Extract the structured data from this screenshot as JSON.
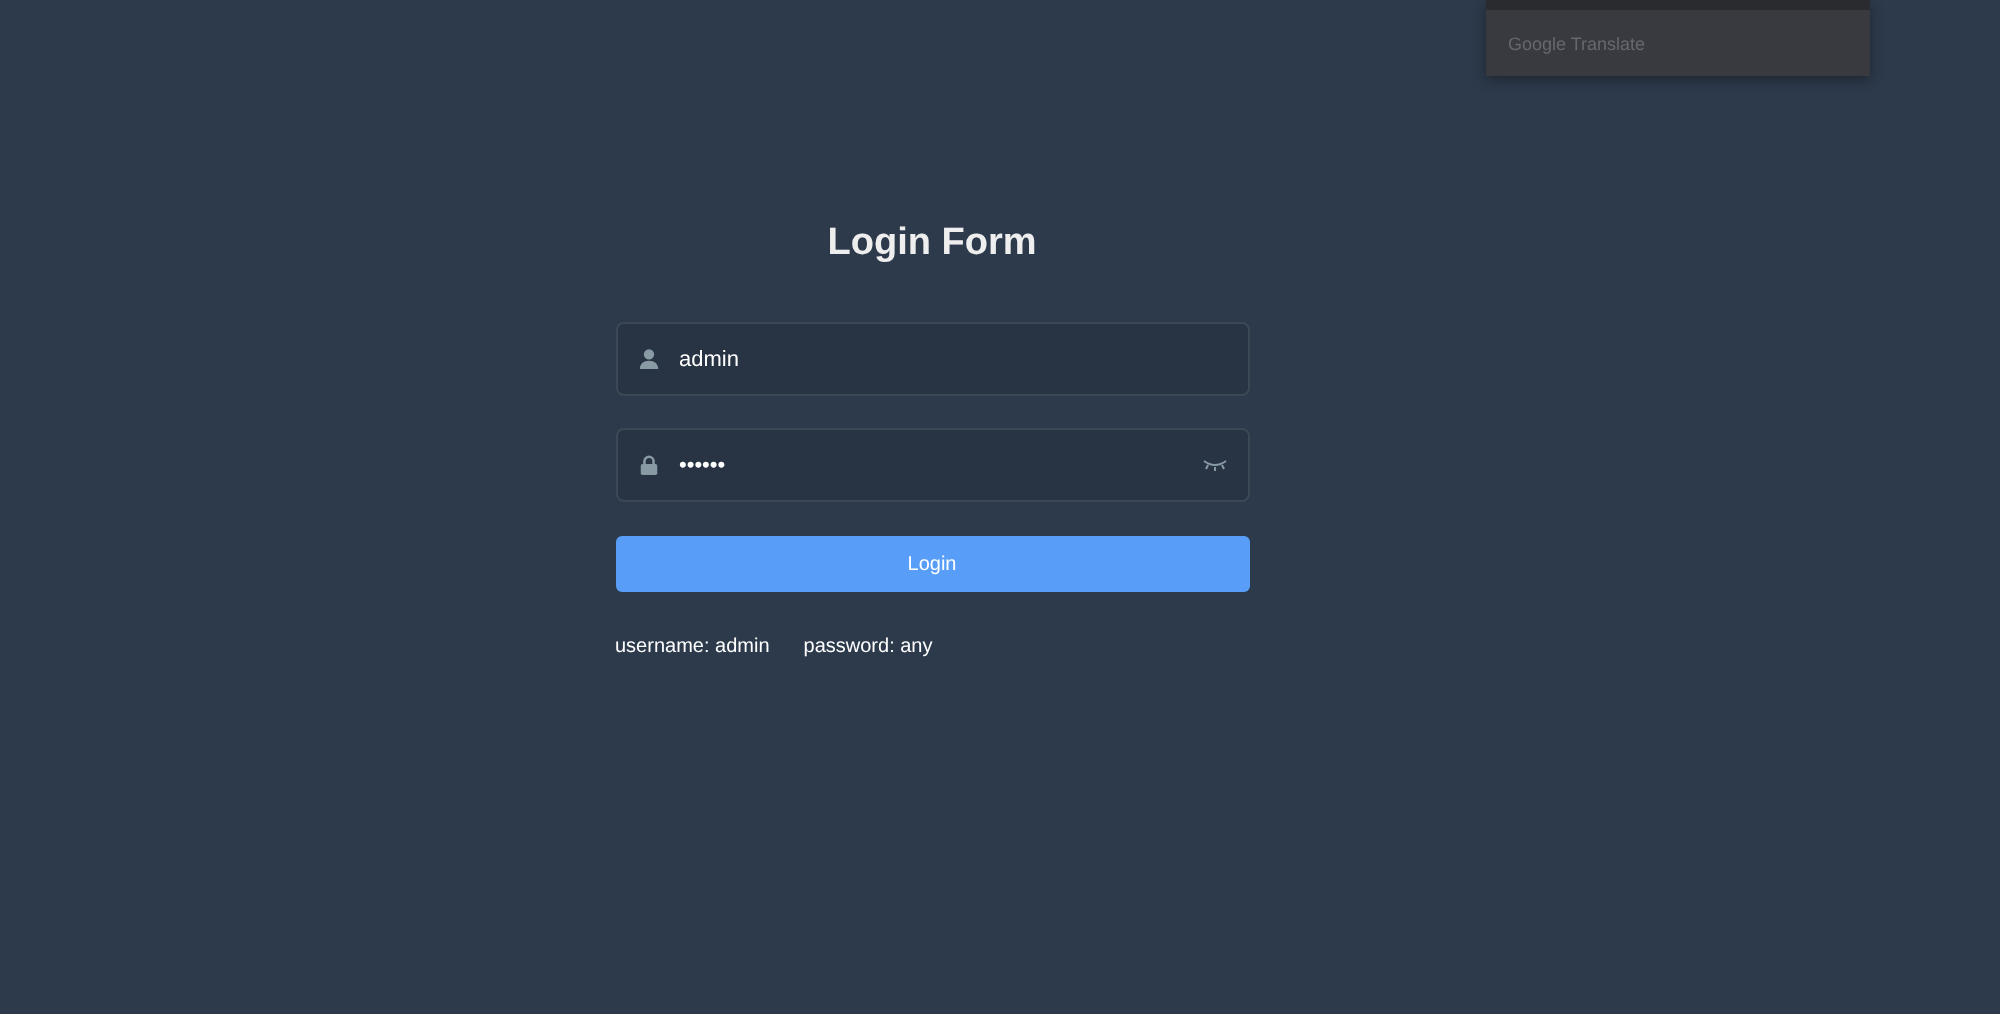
{
  "translate_popup": {
    "label": "Google Translate"
  },
  "login_form": {
    "title": "Login Form",
    "username": {
      "value": "admin"
    },
    "password": {
      "value": "••••••",
      "visible": false
    },
    "button": "Login",
    "hints": [
      "username: admin",
      "password: any"
    ]
  }
}
